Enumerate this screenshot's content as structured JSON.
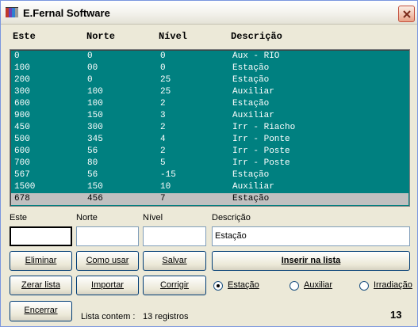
{
  "window": {
    "title": "E.Fernal Software",
    "icon": "app-icon",
    "close_icon": "close-icon"
  },
  "list": {
    "columns": [
      "Este",
      "Norte",
      "Nível",
      "Descrição"
    ],
    "rows": [
      [
        "0",
        "0",
        "0",
        "Aux - RIO"
      ],
      [
        "100",
        "00",
        "0",
        "Estação"
      ],
      [
        "200",
        "0",
        "25",
        "Estação"
      ],
      [
        "300",
        "100",
        "25",
        "Auxiliar"
      ],
      [
        "600",
        "100",
        "2",
        "Estação"
      ],
      [
        "900",
        "150",
        "3",
        "Auxiliar"
      ],
      [
        "450",
        "300",
        "2",
        "Irr - Riacho"
      ],
      [
        "500",
        "345",
        "4",
        "Irr - Ponte"
      ],
      [
        "600",
        "56",
        "2",
        "Irr - Poste"
      ],
      [
        "700",
        "80",
        "5",
        "Irr - Poste"
      ],
      [
        "567",
        "56",
        "-15",
        "Estação"
      ],
      [
        "1500",
        "150",
        "10",
        "Auxiliar"
      ],
      [
        "678",
        "456",
        "7",
        "Estação"
      ]
    ],
    "selected_row": 12,
    "background": "#008080",
    "selected_color": "#c0c0c0"
  },
  "form": {
    "labels": {
      "este": "Este",
      "norte": "Norte",
      "nivel": "Nível",
      "descricao": "Descrição"
    },
    "values": {
      "este": "",
      "norte": "",
      "nivel": "",
      "descricao": "Estação"
    }
  },
  "buttons": {
    "eliminar": "Eliminar",
    "como_usar": "Como usar",
    "salvar": "Salvar",
    "inserir": "Inserir na lista",
    "zerar": "Zerar lista",
    "importar": "Importar",
    "corrigir": "Corrigir",
    "encerrar": "Encerrar"
  },
  "radios": {
    "estacao": "Estação",
    "auxiliar": "Auxiliar",
    "irradiacao": "Irradiação",
    "selected": "estacao"
  },
  "status": {
    "label": "Lista contem :",
    "value": "13 registros",
    "count": "13"
  }
}
